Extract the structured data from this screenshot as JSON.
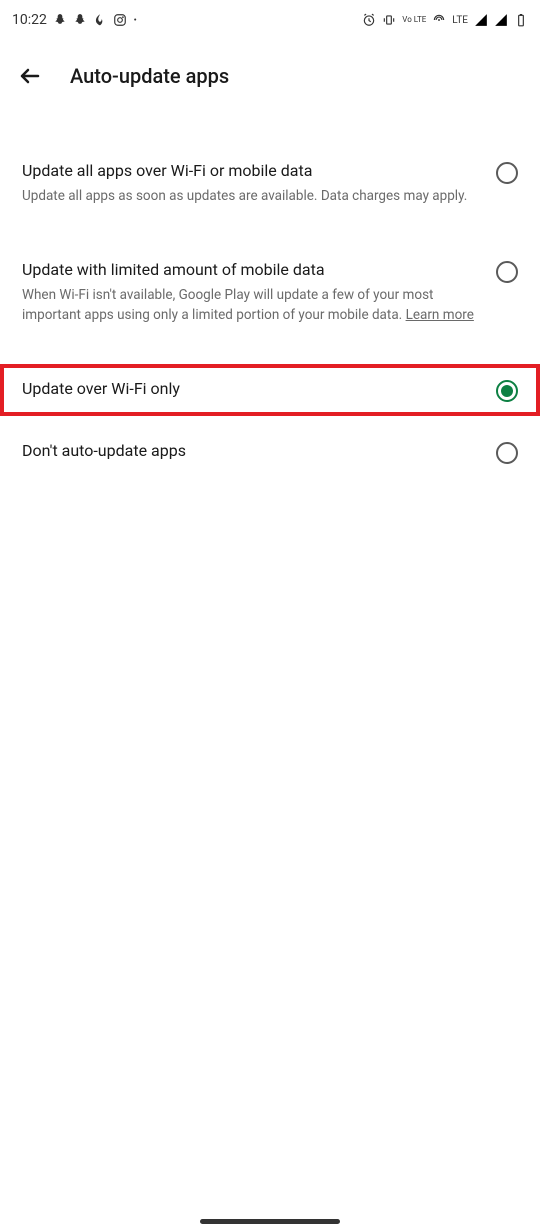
{
  "status_bar": {
    "time": "10:22",
    "lte_label": "LTE",
    "volte_label": "Vo LTE"
  },
  "header": {
    "title": "Auto-update apps"
  },
  "options": {
    "all": {
      "title": "Update all apps over Wi-Fi or mobile data",
      "description": "Update all apps as soon as updates are available. Data charges may apply."
    },
    "limited": {
      "title": "Update with limited amount of mobile data",
      "description": "When Wi-Fi isn't available, Google Play will update a few of your most important apps using only a limited portion of your mobile data. ",
      "learn_more": "Learn more"
    },
    "wifi_only": {
      "title": "Update over Wi-Fi only"
    },
    "dont": {
      "title": "Don't auto-update apps"
    }
  }
}
